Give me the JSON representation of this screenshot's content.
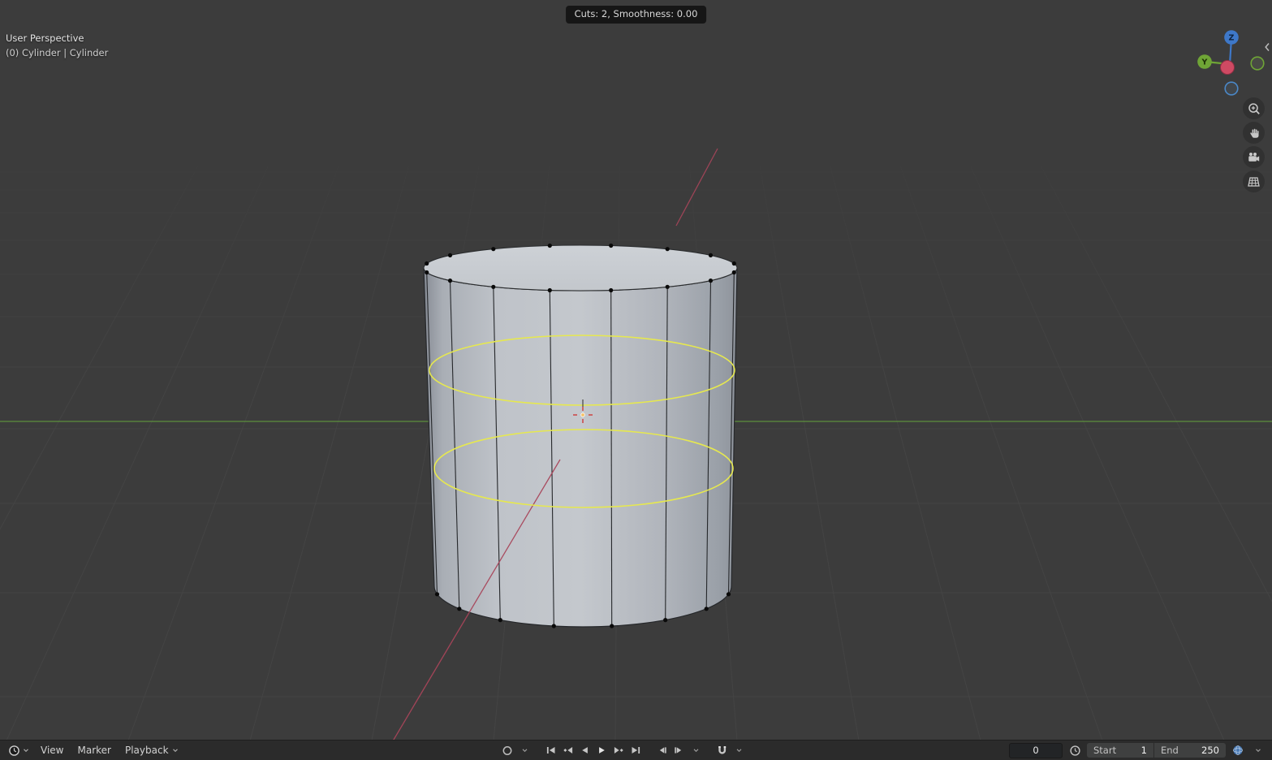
{
  "header": {
    "status": "Cuts: 2, Smoothness: 0.00"
  },
  "viewport": {
    "view_label": "User Perspective",
    "object_label": "(0) Cylinder | Cylinder"
  },
  "gizmo": {
    "z_label": "Z",
    "y_label": "Y"
  },
  "timeline": {
    "menu_view": "View",
    "menu_marker": "Marker",
    "menu_playback": "Playback",
    "current_frame": "0",
    "start_label": "Start",
    "start_value": "1",
    "end_label": "End",
    "end_value": "250"
  },
  "icons": {
    "right_toolbar": [
      "zoom-icon",
      "pan-hand-icon",
      "camera-view-icon",
      "ortho-grid-icon"
    ],
    "transport": [
      "record-icon",
      "jump-start-icon",
      "prev-keyframe-icon",
      "play-reverse-icon",
      "play-icon",
      "next-keyframe-icon",
      "jump-end-icon",
      "prev-frame-icon",
      "next-frame-icon",
      "snap-magnet-icon"
    ],
    "misc": [
      "editor-type-clock-icon",
      "preview-range-clock-icon",
      "scene-globe-icon",
      "chevron-down-icon",
      "collapse-left-icon"
    ]
  },
  "colors": {
    "viewport_bg": "#3c3c3c",
    "grid_line": "#464646",
    "axis_green": "#5f9a3c",
    "axis_red": "#a8455a",
    "loopcut_yellow": "#e6e84f",
    "gizmo_blue": "#3e78c9",
    "gizmo_green": "#6fa536",
    "gizmo_red": "#cf4a63",
    "header_pill_bg": "#141414",
    "timeline_bg": "#2b2b2b"
  }
}
